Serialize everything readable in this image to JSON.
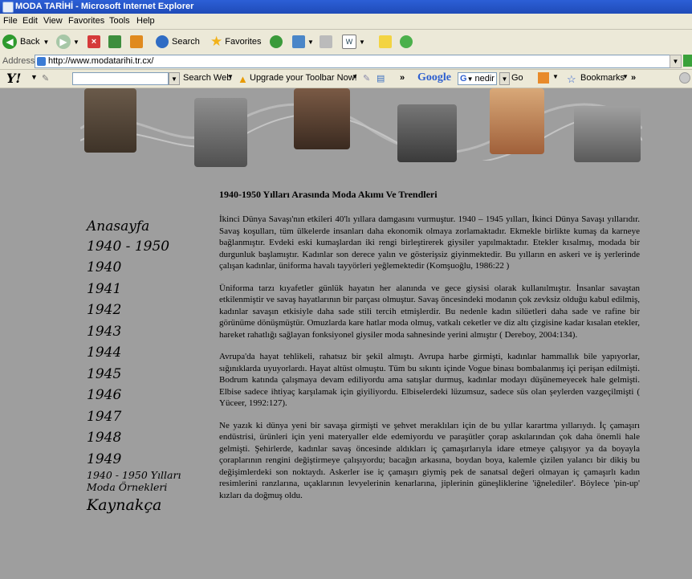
{
  "window": {
    "title": "MODA TARİHİ - Microsoft Internet Explorer"
  },
  "menu": [
    "File",
    "Edit",
    "View",
    "Favorites",
    "Tools",
    "Help"
  ],
  "toolbar": {
    "back_label": "Back",
    "search_label": "Search",
    "favorites_label": "Favorites"
  },
  "address": {
    "label": "Address",
    "url": "http://www.modatarihi.tr.cx/"
  },
  "yahoo_toolbar": {
    "logo": "Y!",
    "search_web_label": "Search Web",
    "upgrade_label": "Upgrade your Toolbar Now!",
    "google_label": "Google",
    "google_query": "nedir",
    "go_label": "Go",
    "bookmarks_label": "Bookmarks"
  },
  "nav": {
    "items": [
      "Anasayfa",
      "1940 - 1950",
      "1940",
      "1941",
      "1942",
      "1943",
      "1944",
      "1945",
      "1946",
      "1947",
      "1948",
      "1949",
      "1940 - 1950 Yılları Moda Örnekleri",
      "Kaynakça"
    ]
  },
  "article": {
    "title": "1940-1950 Yılları Arasında Moda Akımı Ve Trendleri",
    "paragraphs": [
      "İkinci Dünya Savaşı'nın etkileri 40'lı yıllara damgasını vurmuştur. 1940 – 1945 yılları, İkinci Dünya Savaşı yıllarıdır. Savaş koşulları, tüm ülkelerde insanları daha ekonomik olmaya zorlamaktadır. Ekmekle birlikte kumaş da karneye bağlanmıştır. Evdeki eski kumaşlardan iki rengi birleştirerek giysiler yapılmaktadır. Etekler kısalmış, modada bir durgunluk başlamıştır. Kadınlar son derece yalın ve gösterişsiz giyinmektedir. Bu yılların en askeri ve iş yerlerinde çalışan kadınlar, üniforma havalı tayyörleri yeğlemektedir (Komşuoğlu, 1986:22 )",
      "Üniforma tarzı kıyafetler günlük hayatın her alanında ve gece giysisi olarak kullanılmıştır. İnsanlar savaştan etkilenmiştir ve savaş hayatlarının bir parçası olmuştur. Savaş öncesindeki modanın çok zevksiz olduğu kabul edilmiş, kadınlar savaşın etkisiyle daha sade stili tercih etmişlerdir. Bu nedenle kadın silüetleri daha sade ve rafine bir görünüme dönüşmüştür. Omuzlarda kare hatlar moda olmuş, vatkalı ceketler ve diz altı çizgisine kadar kısalan etekler, hareket rahatlığı sağlayan fonksiyonel giysiler moda sahnesinde yerini almıştır ( Dereboy, 2004:134).",
      "Avrupa'da hayat tehlikeli, rahatsız bir şekil almıştı. Avrupa harbe girmişti, kadınlar hammallık bile yapıyorlar, sığınıklarda uyuyorlardı. Hayat altüst olmuştu. Tüm bu sıkıntı içinde Vogue binası bombalanmış içi perişan edilmişti. Bodrum katında çalışmaya devam ediliyordu ama satışlar durmuş, kadınlar modayı düşünemeyecek hale gelmişti. Elbise sadece ihtiyaç karşılamak için giyiliyordu. Elbiselerdeki lüzumsuz, sadece süs olan şeylerden vazgeçilmişti ( Yüceer, 1992:127).",
      "Ne yazık ki dünya yeni bir savaşa girmişti ve şehvet meraklıları için de bu yıllar karartma yıllarıydı. İç çamaşırı endüstrisi, ürünleri için yeni materyaller elde edemiyordu ve paraşütler çorap askılarından çok daha önemli hale gelmişti. Şehirlerde, kadınlar savaş öncesinde aldıkları iç çamaşırlarıyla idare etmeye çalışıyor ya da boyayla çoraplarının rengini değiştirmeye çalışıyordu; bacağın arkasına, boydan boya, kalemle çizilen yalancı bir dikiş bu değişimlerdeki son noktaydı. Askerler ise iç çamaşırı giymiş pek de sanatsal değeri olmayan iç çamaşırlı kadın resimlerini ranzlarına, uçaklarının levyelerinin kenarlarına, jiplerinin güneşliklerine 'iğnelediler'. Böylece 'pin-up' kızları da doğmuş oldu."
    ]
  }
}
